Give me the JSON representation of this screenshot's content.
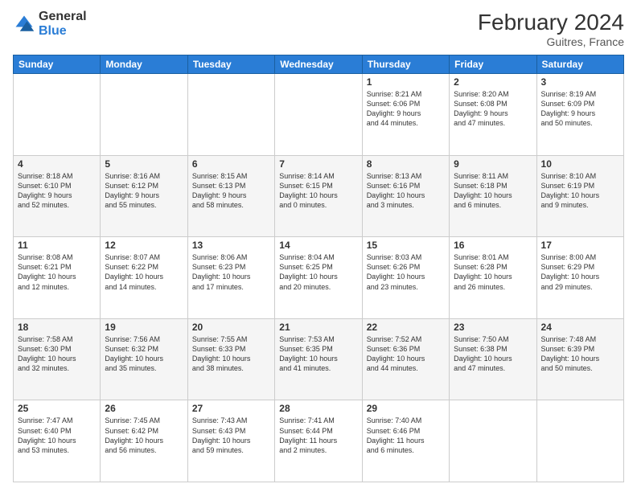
{
  "header": {
    "logo_line1": "General",
    "logo_line2": "Blue",
    "month_title": "February 2024",
    "location": "Guitres, France"
  },
  "days_of_week": [
    "Sunday",
    "Monday",
    "Tuesday",
    "Wednesday",
    "Thursday",
    "Friday",
    "Saturday"
  ],
  "weeks": [
    [
      {
        "day": "",
        "info": ""
      },
      {
        "day": "",
        "info": ""
      },
      {
        "day": "",
        "info": ""
      },
      {
        "day": "",
        "info": ""
      },
      {
        "day": "1",
        "info": "Sunrise: 8:21 AM\nSunset: 6:06 PM\nDaylight: 9 hours\nand 44 minutes."
      },
      {
        "day": "2",
        "info": "Sunrise: 8:20 AM\nSunset: 6:08 PM\nDaylight: 9 hours\nand 47 minutes."
      },
      {
        "day": "3",
        "info": "Sunrise: 8:19 AM\nSunset: 6:09 PM\nDaylight: 9 hours\nand 50 minutes."
      }
    ],
    [
      {
        "day": "4",
        "info": "Sunrise: 8:18 AM\nSunset: 6:10 PM\nDaylight: 9 hours\nand 52 minutes."
      },
      {
        "day": "5",
        "info": "Sunrise: 8:16 AM\nSunset: 6:12 PM\nDaylight: 9 hours\nand 55 minutes."
      },
      {
        "day": "6",
        "info": "Sunrise: 8:15 AM\nSunset: 6:13 PM\nDaylight: 9 hours\nand 58 minutes."
      },
      {
        "day": "7",
        "info": "Sunrise: 8:14 AM\nSunset: 6:15 PM\nDaylight: 10 hours\nand 0 minutes."
      },
      {
        "day": "8",
        "info": "Sunrise: 8:13 AM\nSunset: 6:16 PM\nDaylight: 10 hours\nand 3 minutes."
      },
      {
        "day": "9",
        "info": "Sunrise: 8:11 AM\nSunset: 6:18 PM\nDaylight: 10 hours\nand 6 minutes."
      },
      {
        "day": "10",
        "info": "Sunrise: 8:10 AM\nSunset: 6:19 PM\nDaylight: 10 hours\nand 9 minutes."
      }
    ],
    [
      {
        "day": "11",
        "info": "Sunrise: 8:08 AM\nSunset: 6:21 PM\nDaylight: 10 hours\nand 12 minutes."
      },
      {
        "day": "12",
        "info": "Sunrise: 8:07 AM\nSunset: 6:22 PM\nDaylight: 10 hours\nand 14 minutes."
      },
      {
        "day": "13",
        "info": "Sunrise: 8:06 AM\nSunset: 6:23 PM\nDaylight: 10 hours\nand 17 minutes."
      },
      {
        "day": "14",
        "info": "Sunrise: 8:04 AM\nSunset: 6:25 PM\nDaylight: 10 hours\nand 20 minutes."
      },
      {
        "day": "15",
        "info": "Sunrise: 8:03 AM\nSunset: 6:26 PM\nDaylight: 10 hours\nand 23 minutes."
      },
      {
        "day": "16",
        "info": "Sunrise: 8:01 AM\nSunset: 6:28 PM\nDaylight: 10 hours\nand 26 minutes."
      },
      {
        "day": "17",
        "info": "Sunrise: 8:00 AM\nSunset: 6:29 PM\nDaylight: 10 hours\nand 29 minutes."
      }
    ],
    [
      {
        "day": "18",
        "info": "Sunrise: 7:58 AM\nSunset: 6:30 PM\nDaylight: 10 hours\nand 32 minutes."
      },
      {
        "day": "19",
        "info": "Sunrise: 7:56 AM\nSunset: 6:32 PM\nDaylight: 10 hours\nand 35 minutes."
      },
      {
        "day": "20",
        "info": "Sunrise: 7:55 AM\nSunset: 6:33 PM\nDaylight: 10 hours\nand 38 minutes."
      },
      {
        "day": "21",
        "info": "Sunrise: 7:53 AM\nSunset: 6:35 PM\nDaylight: 10 hours\nand 41 minutes."
      },
      {
        "day": "22",
        "info": "Sunrise: 7:52 AM\nSunset: 6:36 PM\nDaylight: 10 hours\nand 44 minutes."
      },
      {
        "day": "23",
        "info": "Sunrise: 7:50 AM\nSunset: 6:38 PM\nDaylight: 10 hours\nand 47 minutes."
      },
      {
        "day": "24",
        "info": "Sunrise: 7:48 AM\nSunset: 6:39 PM\nDaylight: 10 hours\nand 50 minutes."
      }
    ],
    [
      {
        "day": "25",
        "info": "Sunrise: 7:47 AM\nSunset: 6:40 PM\nDaylight: 10 hours\nand 53 minutes."
      },
      {
        "day": "26",
        "info": "Sunrise: 7:45 AM\nSunset: 6:42 PM\nDaylight: 10 hours\nand 56 minutes."
      },
      {
        "day": "27",
        "info": "Sunrise: 7:43 AM\nSunset: 6:43 PM\nDaylight: 10 hours\nand 59 minutes."
      },
      {
        "day": "28",
        "info": "Sunrise: 7:41 AM\nSunset: 6:44 PM\nDaylight: 11 hours\nand 2 minutes."
      },
      {
        "day": "29",
        "info": "Sunrise: 7:40 AM\nSunset: 6:46 PM\nDaylight: 11 hours\nand 6 minutes."
      },
      {
        "day": "",
        "info": ""
      },
      {
        "day": "",
        "info": ""
      }
    ]
  ]
}
